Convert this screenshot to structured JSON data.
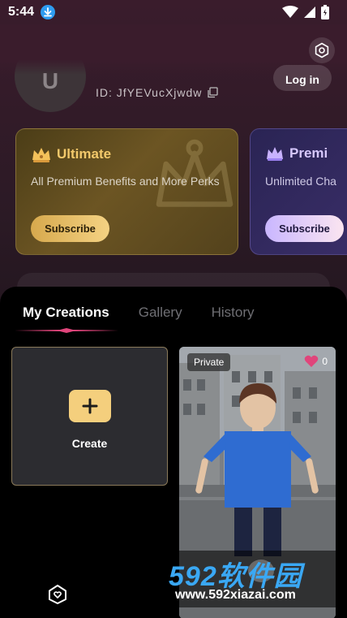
{
  "status_bar": {
    "time": "5:44"
  },
  "profile": {
    "avatar_initial": "U",
    "user_id": "ID:  JfYEVucXjwdw",
    "login_label": "Log in"
  },
  "memberships": [
    {
      "title": "Ultimate",
      "description": "All Premium Benefits and More Perks",
      "button": "Subscribe"
    },
    {
      "title": "Premi",
      "description": "Unlimited Cha",
      "button": "Subscribe"
    }
  ],
  "tabs": [
    {
      "label": "My Creations",
      "active": true
    },
    {
      "label": "Gallery",
      "active": false
    },
    {
      "label": "History",
      "active": false
    }
  ],
  "create_tile": {
    "label": "Create"
  },
  "creation": {
    "visibility": "Private",
    "likes": "0"
  },
  "watermark": {
    "brand": "592软件园",
    "url": "www.592xiazai.com"
  },
  "colors": {
    "gold_accent": "#f4cf7d",
    "pink_accent": "#e0457b",
    "sheet_bg": "#000000"
  },
  "icons": [
    "download-icon",
    "wifi-icon",
    "signal-icon",
    "battery-icon",
    "settings-icon",
    "copy-icon",
    "crown-icon",
    "plus-icon",
    "heart-icon",
    "home-icon"
  ]
}
